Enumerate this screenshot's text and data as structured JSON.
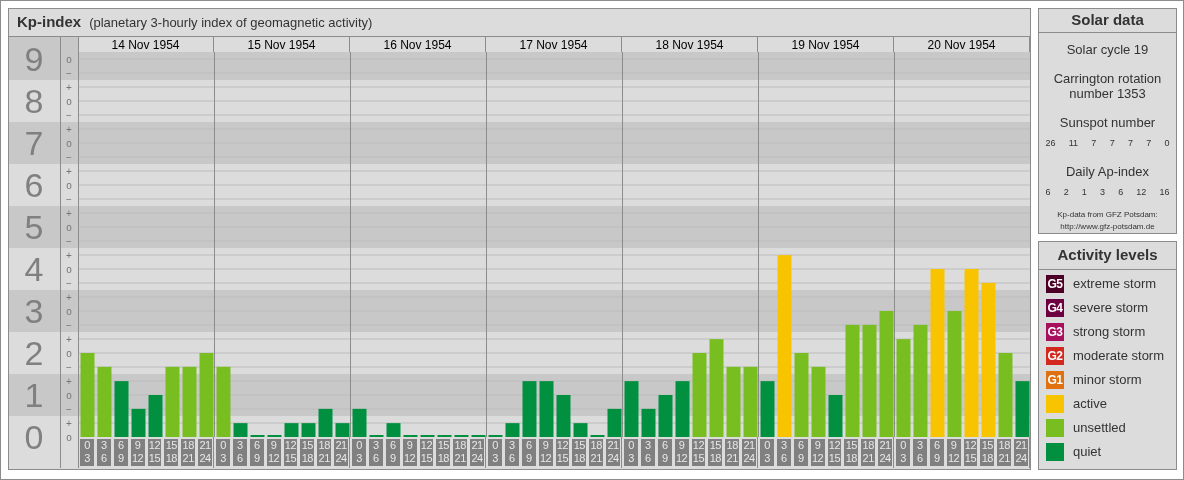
{
  "kp_panel": {
    "title": "Kp-index",
    "subtitle": "(planetary 3-hourly index of geomagnetic activity)",
    "days": [
      "14 Nov 1954",
      "15 Nov 1954",
      "16 Nov 1954",
      "17 Nov 1954",
      "18 Nov 1954",
      "19 Nov 1954",
      "20 Nov 1954"
    ],
    "y_minor_labels": [
      "o",
      "−",
      "+",
      "o",
      "−",
      "+",
      "o",
      "−",
      "+",
      "o",
      "−",
      "+",
      "o",
      "−",
      "+",
      "o",
      "−",
      "+",
      "o",
      "−",
      "+",
      "o",
      "−",
      "+",
      "o",
      "−",
      "+",
      "o"
    ],
    "chart_data": {
      "type": "bar",
      "grid": true,
      "ylim": [
        0,
        9.1667
      ],
      "yticks": [
        0,
        1,
        2,
        3,
        4,
        5,
        6,
        7,
        8,
        9
      ],
      "categories": [
        "0\n3",
        "3\n6",
        "6\n9",
        "9\n12",
        "12\n15",
        "15\n18",
        "18\n21",
        "21\n24",
        "0\n3",
        "3\n6",
        "6\n9",
        "9\n12",
        "12\n15",
        "15\n18",
        "18\n21",
        "21\n24",
        "0\n3",
        "3\n6",
        "6\n9",
        "9\n12",
        "12\n15",
        "15\n18",
        "18\n21",
        "21\n24",
        "0\n3",
        "3\n6",
        "6\n9",
        "9\n12",
        "12\n15",
        "15\n18",
        "18\n21",
        "21\n24",
        "0\n3",
        "3\n6",
        "6\n9",
        "9\n12",
        "12\n15",
        "15\n18",
        "18\n21",
        "21\n24",
        "0\n3",
        "3\n6",
        "6\n9",
        "9\n12",
        "12\n15",
        "15\n18",
        "18\n21",
        "21\n24",
        "0\n3",
        "3\n6",
        "6\n9",
        "9\n12",
        "12\n15",
        "15\n18",
        "18\n21",
        "21\n24"
      ],
      "series": [
        {
          "name": "active",
          "color": "#f8c400",
          "values": [
            null,
            null,
            null,
            null,
            null,
            null,
            null,
            null,
            null,
            null,
            null,
            null,
            null,
            null,
            null,
            null,
            null,
            null,
            null,
            null,
            null,
            null,
            null,
            null,
            null,
            null,
            null,
            null,
            null,
            null,
            null,
            null,
            null,
            null,
            null,
            null,
            null,
            null,
            null,
            null,
            null,
            4.33,
            null,
            null,
            null,
            null,
            null,
            null,
            null,
            null,
            4,
            null,
            4,
            3.67,
            null,
            null
          ]
        },
        {
          "name": "unsettled",
          "color": "#78be20",
          "values": [
            2,
            1.67,
            null,
            null,
            null,
            1.67,
            1.67,
            2,
            1.67,
            null,
            null,
            null,
            null,
            null,
            null,
            null,
            null,
            null,
            null,
            null,
            null,
            null,
            null,
            null,
            null,
            null,
            null,
            null,
            null,
            null,
            null,
            null,
            null,
            null,
            null,
            null,
            2,
            2.33,
            1.67,
            1.67,
            null,
            null,
            2,
            1.67,
            null,
            2.67,
            2.67,
            3,
            2.33,
            2.67,
            null,
            3,
            null,
            null,
            2,
            null
          ]
        },
        {
          "name": "quiet",
          "color": "#009040",
          "values": [
            null,
            null,
            1.33,
            0.67,
            1,
            null,
            null,
            null,
            null,
            0.33,
            0,
            0,
            0.33,
            0.33,
            0.67,
            0.33,
            0.67,
            0,
            0.33,
            0,
            0,
            0,
            0,
            0,
            0,
            0.33,
            1.33,
            1.33,
            1,
            0.33,
            0,
            0.67,
            1.33,
            0.67,
            1,
            1.33,
            null,
            null,
            null,
            null,
            1.33,
            null,
            null,
            null,
            1,
            null,
            null,
            null,
            null,
            null,
            null,
            null,
            null,
            null,
            null,
            1.33
          ]
        }
      ]
    }
  },
  "solar_data": {
    "title": "Solar data",
    "solar_cycle": "Solar cycle 19",
    "carrington": "Carrington rotation number 1353",
    "sunspot_title": "Sunspot number",
    "sunspot_values": [
      "26",
      "11",
      "7",
      "7",
      "7",
      "7",
      "0"
    ],
    "ap_title": "Daily Ap-index",
    "ap_values": [
      "6",
      "2",
      "1",
      "3",
      "6",
      "12",
      "16"
    ],
    "source": "Kp-data from GFZ Potsdam:",
    "source_url": "http://www.gfz-potsdam.de"
  },
  "legend": {
    "title": "Activity levels",
    "items": [
      {
        "badge": "G5",
        "label": "extreme storm",
        "color": "#4d0026"
      },
      {
        "badge": "G4",
        "label": "severe storm",
        "color": "#6d0040"
      },
      {
        "badge": "G3",
        "label": "strong storm",
        "color": "#a8105e"
      },
      {
        "badge": "G2",
        "label": "moderate storm",
        "color": "#d2281e"
      },
      {
        "badge": "G1",
        "label": "minor storm",
        "color": "#e07010"
      }
    ]
  }
}
